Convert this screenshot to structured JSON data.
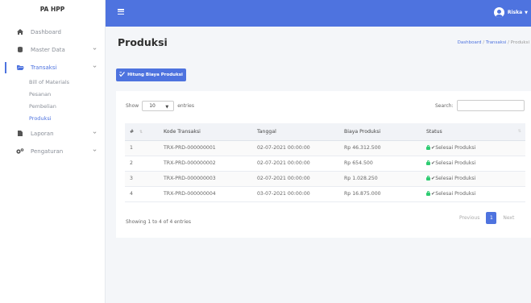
{
  "brand": "PA HPP",
  "sidebar": {
    "items": [
      {
        "label": "Dashboard"
      },
      {
        "label": "Master Data"
      },
      {
        "label": "Transaksi"
      },
      {
        "label": "Laporan"
      },
      {
        "label": "Pengaturan"
      }
    ],
    "sub_items": [
      {
        "label": "Bill of Materials"
      },
      {
        "label": "Pesanan"
      },
      {
        "label": "Pembelian"
      },
      {
        "label": "Produksi"
      }
    ]
  },
  "topbar": {
    "user_name": "Riska"
  },
  "page": {
    "title": "Produksi",
    "breadcrumb": {
      "item1": "Dashboard",
      "item2": "Transaksi",
      "item3": "Produksi",
      "separator": "/"
    }
  },
  "actions": {
    "hitung_label": "Hitung Biaya Produksi"
  },
  "table_controls": {
    "show_label": "Show",
    "entries_value": "10",
    "entries_label": "entries",
    "search_label": "Search:",
    "search_value": ""
  },
  "table": {
    "headers": {
      "no": "#",
      "kode": "Kode Transaksi",
      "tanggal": "Tanggal",
      "biaya": "Biaya Produksi",
      "status": "Status"
    },
    "rows": [
      {
        "no": "1",
        "kode": "TRX-PRD-000000001",
        "tanggal": "02-07-2021 00:00:00",
        "biaya": "Rp 46.312.500",
        "status": "Selesai Produksi"
      },
      {
        "no": "2",
        "kode": "TRX-PRD-000000002",
        "tanggal": "02-07-2021 00:00:00",
        "biaya": "Rp 654.500",
        "status": "Selesai Produksi"
      },
      {
        "no": "3",
        "kode": "TRX-PRD-000000003",
        "tanggal": "02-07-2021 00:00:00",
        "biaya": "Rp 1.028.250",
        "status": "Selesai Produksi"
      },
      {
        "no": "4",
        "kode": "TRX-PRD-000000004",
        "tanggal": "03-07-2021 00:00:00",
        "biaya": "Rp 16.875.000",
        "status": "Selesai Produksi"
      }
    ]
  },
  "footer": {
    "info": "Showing 1 to 4 of 4 entries",
    "previous": "Previous",
    "current_page": "1",
    "next": "Next"
  },
  "colors": {
    "primary": "#4e73df",
    "success": "#2ecc71",
    "background": "#f4f6f9"
  }
}
